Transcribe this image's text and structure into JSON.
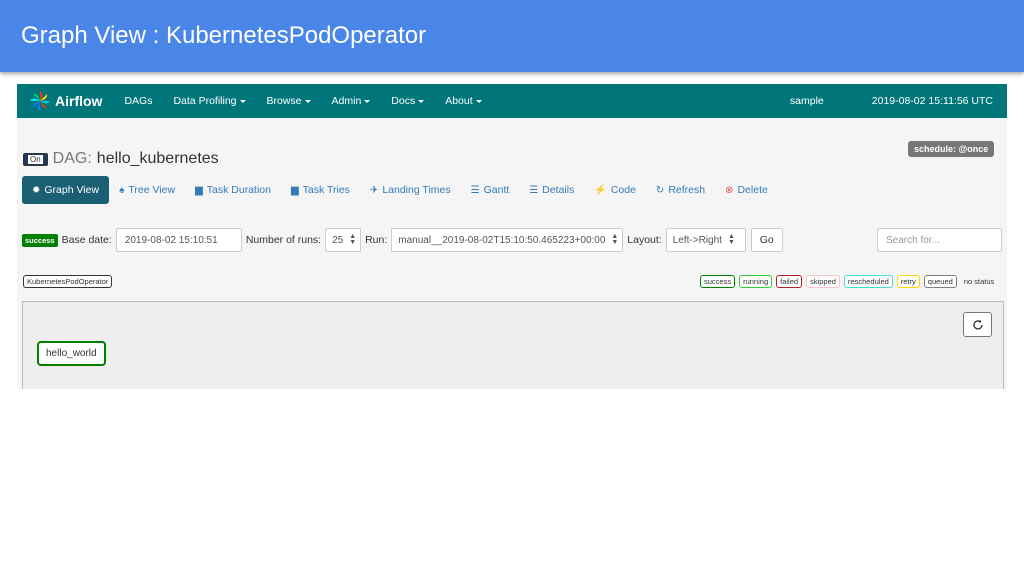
{
  "slide": {
    "title": "Graph View : KubernetesPodOperator"
  },
  "navbar": {
    "brand": "Airflow",
    "items": [
      {
        "label": "DAGs",
        "dropdown": false
      },
      {
        "label": "Data Profiling",
        "dropdown": true
      },
      {
        "label": "Browse",
        "dropdown": true
      },
      {
        "label": "Admin",
        "dropdown": true
      },
      {
        "label": "Docs",
        "dropdown": true
      },
      {
        "label": "About",
        "dropdown": true
      }
    ],
    "user": "sample",
    "time": "2019-08-02 15:11:56 UTC"
  },
  "dag": {
    "toggle": "On",
    "label": "DAG:",
    "name": "hello_kubernetes",
    "schedule": "schedule: @once"
  },
  "tabs": [
    {
      "label": "Graph View",
      "icon": "asterisk-icon"
    },
    {
      "label": "Tree View",
      "icon": "tree-icon"
    },
    {
      "label": "Task Duration",
      "icon": "bar-chart-icon"
    },
    {
      "label": "Task Tries",
      "icon": "bar-chart-icon"
    },
    {
      "label": "Landing Times",
      "icon": "plane-icon"
    },
    {
      "label": "Gantt",
      "icon": "gantt-icon"
    },
    {
      "label": "Details",
      "icon": "list-icon"
    },
    {
      "label": "Code",
      "icon": "flash-icon"
    },
    {
      "label": "Refresh",
      "icon": "refresh-icon"
    },
    {
      "label": "Delete",
      "icon": "delete-icon"
    }
  ],
  "form": {
    "state_badge": "success",
    "base_date_label": "Base date:",
    "base_date": "2019-08-02 15:10:51",
    "num_runs_label": "Number of runs:",
    "num_runs": "25",
    "run_label": "Run:",
    "run": "manual__2019-08-02T15:10:50.465223+00:00",
    "layout_label": "Layout:",
    "layout": "Left->Right",
    "go": "Go",
    "search_placeholder": "Search for..."
  },
  "legend": {
    "operator": "KubernetesPodOperator",
    "states": [
      {
        "label": "success",
        "color": "#008000"
      },
      {
        "label": "running",
        "color": "#32cd32"
      },
      {
        "label": "failed",
        "color": "#b22222"
      },
      {
        "label": "skipped",
        "color": "#ffc0cb"
      },
      {
        "label": "rescheduled",
        "color": "#40e0d0"
      },
      {
        "label": "retry",
        "color": "#ffd700"
      },
      {
        "label": "queued",
        "color": "#808080"
      },
      {
        "label": "no status",
        "color": ""
      }
    ]
  },
  "graph": {
    "task": "hello_world",
    "task_state_color": "#008000"
  }
}
